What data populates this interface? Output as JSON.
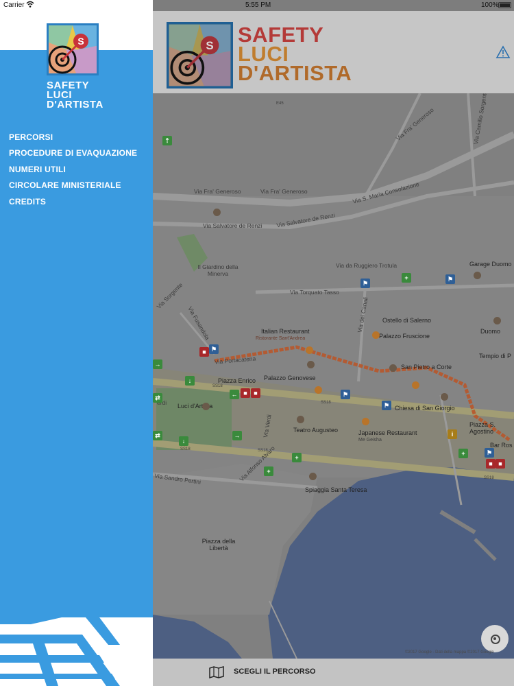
{
  "status_bar": {
    "carrier": "Carrier",
    "time": "5:55 PM",
    "battery": "100%"
  },
  "sidebar": {
    "brand": [
      "SAFETY",
      "LUCI",
      "D'ARTISTA"
    ],
    "menu": [
      {
        "label": "PERCORSI"
      },
      {
        "label": "PROCEDURE DI EVAQUAZIONE"
      },
      {
        "label": "NUMERI UTILI"
      },
      {
        "label": "CIRCOLARE MINISTERIALE"
      },
      {
        "label": "CREDITS"
      }
    ]
  },
  "header": {
    "title_line1": "SAFETY",
    "title_line2": "LUCI",
    "title_line3": "D'ARTISTA"
  },
  "map": {
    "labels": {
      "e45": "E45",
      "via_fra_generoso_1": "Via Fra' Generoso",
      "via_fra_generoso_2": "Via Fra' Generoso",
      "via_fra_generoso_3": "Via Fra' Generoso",
      "via_s_maria": "Via S. Maria Consolazione",
      "via_camillo": "Via Camillo Sorgente",
      "via_salvatore_1": "Via Salvatore de Renzi",
      "via_salvatore_2": "Via Salvatore de Renzi",
      "giardino": "Il Giardino della Minerva",
      "via_ruggiero": "Via da Ruggiero Trotula",
      "via_torquato": "Via Torquato Tasso",
      "garage": "Garage Duomo",
      "ostello": "Ostello di Salerno",
      "italian_restaurant": "Italian Restaurant",
      "ristorante_sant_andrea": "Ristorante Sant'Andrea",
      "palazzo_fruscione": "Palazzo Fruscione",
      "duomo": "Duomo",
      "tempio": "Tempio di P",
      "via_portacatena": "Via Portacatena",
      "san_pietro": "San Pietro a Corte",
      "piazza_enrico": "Piazza Enrico",
      "palazzo_genovese": "Palazzo Genovese",
      "luci_dartista": "Luci d'Artista",
      "chiesa_san_giorgio": "Chiesa di San Giorgio",
      "via_dei_canali": "Via dei Canali",
      "via_sorgente": "Via Sorgente",
      "via_fusandola": "Via Fusandola",
      "teatro": "Teatro Augusteo",
      "japanese_restaurant": "Japanese Restaurant",
      "me_geisha": "Me Geisha",
      "piazza_s_agostino": "Piazza S. Agostino",
      "bar_ros": "Bar Ros",
      "via_verdi": "Via Verdi",
      "via_sandro": "Via Sandro Pertini",
      "via_alfonso": "Via Alfonso Alvaro",
      "spiaggia": "Spiaggia Santa Teresa",
      "piazza_liberta": "Piazza della Libertà",
      "ss18_1": "SS18",
      "ss18_2": "SS18",
      "ss18_3": "SS18",
      "ss18_4": "SS18",
      "ss18_5": "SS18",
      "verdi_short": "erdi"
    },
    "copyright": "©2017 Google - Dati della mappa ©2017 Google"
  },
  "bottom_bar": {
    "label": "SCEGLI IL PERCORSO"
  },
  "colors": {
    "sidebar_blue": "#3a9be0",
    "title_red": "#b43a38",
    "title_orange": "#c07d2e",
    "route_orange": "#b8562a",
    "sea": "#4d5f82"
  },
  "icons": [
    "wifi-icon",
    "battery-icon",
    "app-logo-icon",
    "warning-icon",
    "map-icon",
    "locate-icon"
  ]
}
